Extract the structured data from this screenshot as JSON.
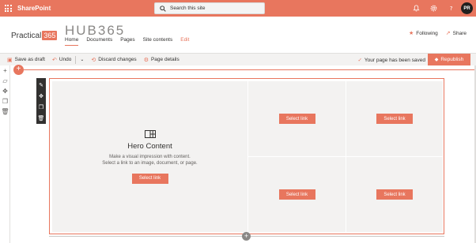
{
  "suitebar": {
    "app_name": "SharePoint",
    "search_placeholder": "Search this site",
    "avatar_initials": "PR",
    "icons": [
      "app-launcher-icon",
      "search-icon",
      "bell-icon",
      "gear-icon",
      "help-icon"
    ],
    "color": "#e8765e"
  },
  "header": {
    "logo_text": "Practical",
    "logo_badge": "365",
    "site_title": "HUB365",
    "nav": [
      {
        "label": "Home",
        "active": true
      },
      {
        "label": "Documents"
      },
      {
        "label": "Pages"
      },
      {
        "label": "Site contents"
      },
      {
        "label": "Edit",
        "accent": true
      }
    ],
    "following_label": "Following",
    "share_label": "Share"
  },
  "commandbar": {
    "save_draft": "Save as draft",
    "undo": "Undo",
    "discard": "Discard changes",
    "page_details": "Page details",
    "saved_status": "Your page has been saved",
    "republish": "Republish"
  },
  "hero": {
    "title": "Hero Content",
    "description_line1": "Make a visual impression with content.",
    "description_line2": "Select a link to an image, document, or page.",
    "tiles": [
      {
        "button": "Select link"
      },
      {
        "button": "Select link"
      },
      {
        "button": "Select link"
      },
      {
        "button": "Select link"
      },
      {
        "button": "Select link"
      }
    ]
  },
  "colors": {
    "accent": "#e8765e",
    "tile_bg": "#f3f2f1",
    "toolbar": "#323130"
  }
}
